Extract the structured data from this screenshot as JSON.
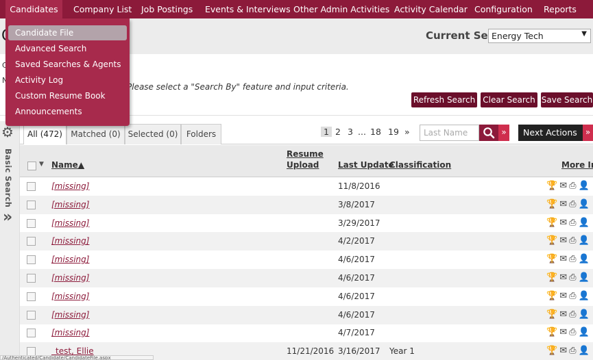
{
  "nav": {
    "items": [
      "Candidates",
      "Company List",
      "Job Postings",
      "Events & Interviews",
      "Other Admin Activities",
      "Activity Calendar",
      "Configuration",
      "Reports"
    ]
  },
  "menu": {
    "items": [
      "Candidate File",
      "Advanced Search",
      "Saved Searches & Agents",
      "Activity Log",
      "Custom Resume Book",
      "Announcements"
    ]
  },
  "header": {
    "page_letter": "C",
    "current_set_label": "Current Set:",
    "current_set_value": "Energy Tech"
  },
  "criteria": {
    "left_letters": [
      "C",
      "N"
    ],
    "message": "Please select a \"Search By\" feature and input criteria.",
    "buttons": [
      "Refresh Search",
      "Clear Search",
      "Save Search"
    ]
  },
  "leftbar": {
    "label": "Basic Search"
  },
  "tabs": [
    "All (472)",
    "Matched (0)",
    "Selected (0)",
    "Folders"
  ],
  "pager": {
    "pages": [
      "1",
      "2",
      "3",
      "...",
      "18",
      "19",
      "»"
    ],
    "current": "1"
  },
  "search": {
    "placeholder": "Last Name"
  },
  "next_actions": "Next Actions",
  "table": {
    "headers": {
      "name": "Name▲",
      "resume_line1": "Resume",
      "resume_line2": "Upload",
      "last_update": "Last Update",
      "classification": "Classification",
      "more_info": "More Info"
    },
    "rows": [
      {
        "name": "[missing]",
        "resume": "",
        "updated": "11/8/2016",
        "classification": ""
      },
      {
        "name": "[missing]",
        "resume": "",
        "updated": "3/8/2017",
        "classification": ""
      },
      {
        "name": "[missing]",
        "resume": "",
        "updated": "3/29/2017",
        "classification": ""
      },
      {
        "name": "[missing]",
        "resume": "",
        "updated": "4/2/2017",
        "classification": ""
      },
      {
        "name": "[missing]",
        "resume": "",
        "updated": "4/6/2017",
        "classification": ""
      },
      {
        "name": "[missing]",
        "resume": "",
        "updated": "4/6/2017",
        "classification": ""
      },
      {
        "name": "[missing]",
        "resume": "",
        "updated": "4/6/2017",
        "classification": ""
      },
      {
        "name": "[missing]",
        "resume": "",
        "updated": "4/6/2017",
        "classification": ""
      },
      {
        "name": "[missing]",
        "resume": "",
        "updated": "4/7/2017",
        "classification": ""
      },
      {
        "name": "_test, Ellie",
        "resume": "11/21/2016",
        "updated": "3/16/2017",
        "classification": "Year 1"
      }
    ]
  },
  "row_icons": [
    "trophy-icon",
    "envelope-icon",
    "printer-icon",
    "person-icon"
  ],
  "status": "/Authenticated/Candidate/CandidateFile.aspx",
  "colors": {
    "nav_bg": "#8c1a3a",
    "menu_bg": "#a72a4c",
    "button_bg": "#6b0f2b",
    "accent": "#cf2e4e"
  }
}
